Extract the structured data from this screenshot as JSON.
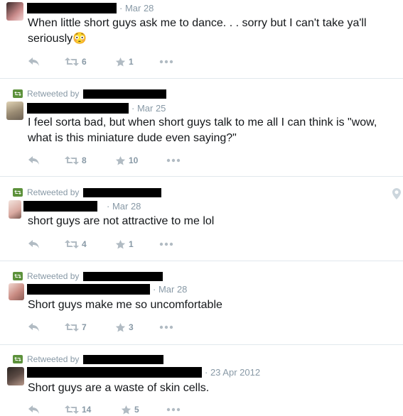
{
  "colors": {
    "muted": "#8899a6",
    "text": "#14171a",
    "retweet": "#5c913b",
    "divider": "#e1e8ed"
  },
  "retweeted_label": "Retweeted by",
  "tweets": [
    {
      "date": "Mar 28",
      "text": "When little short guys ask me to dance. . .  sorry but I can't take ya'll seriously",
      "emoji": "😳",
      "retweets": "6",
      "favorites": "1"
    },
    {
      "date": "Mar 25",
      "text": "I feel sorta bad, but when short guys talk to me all I can think is \"wow, what is this miniature dude even saying?\"",
      "retweets": "8",
      "favorites": "10"
    },
    {
      "date": "Mar 28",
      "text": "short guys are not attractive to me lol",
      "retweets": "4",
      "favorites": "1"
    },
    {
      "date": "Mar 28",
      "text": "Short guys make me so uncomfortable",
      "retweets": "7",
      "favorites": "3"
    },
    {
      "date": "23 Apr 2012",
      "text": "Short guys are a waste of skin cells.",
      "retweets": "14",
      "favorites": "5"
    }
  ]
}
